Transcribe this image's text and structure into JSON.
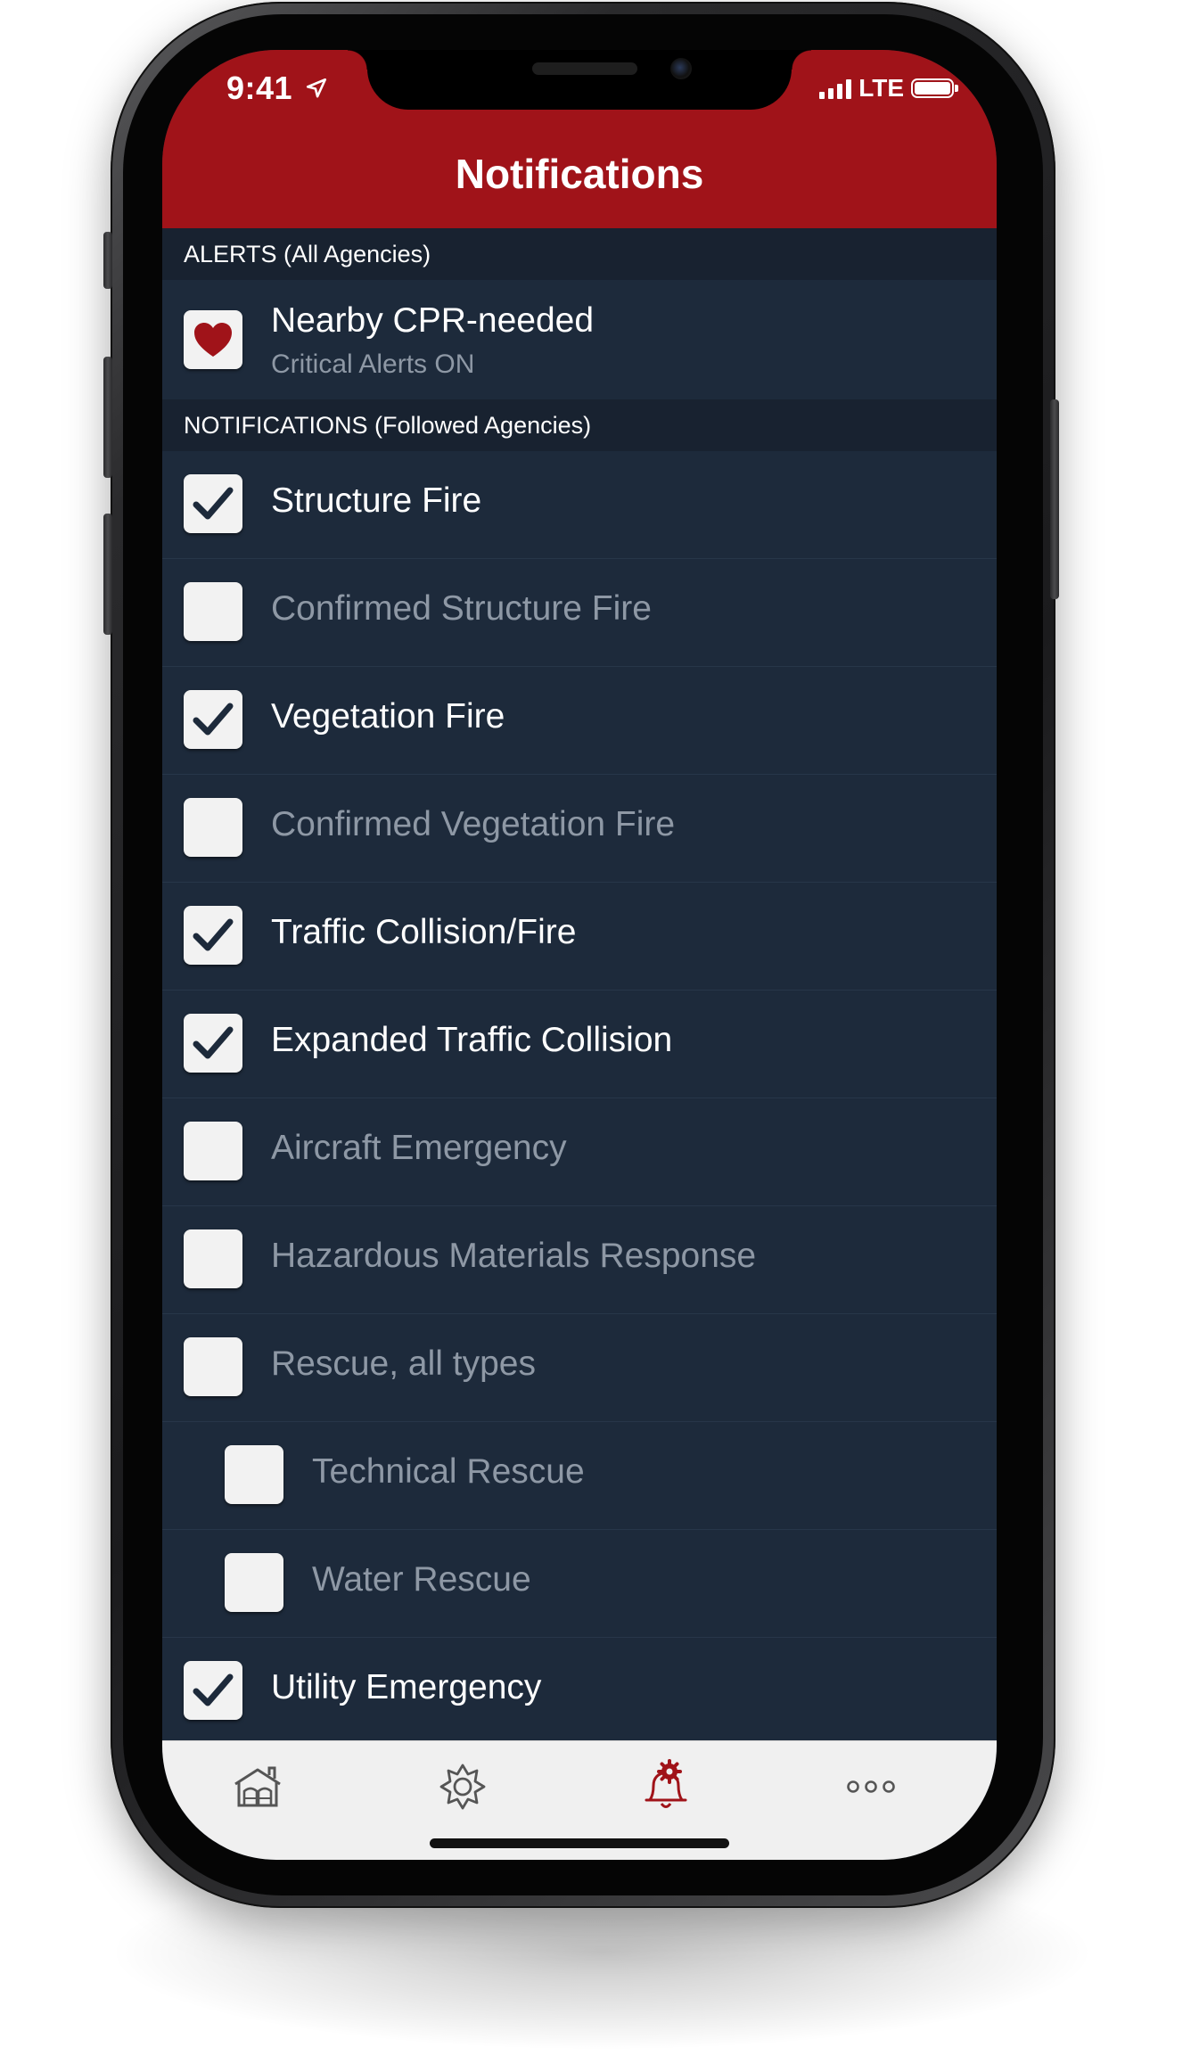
{
  "status_bar": {
    "time": "9:41",
    "network": "LTE",
    "icons": [
      "location-arrow-icon",
      "signal-bars-icon",
      "battery-icon"
    ]
  },
  "header": {
    "title": "Notifications",
    "color": "#a01319"
  },
  "alerts_section": {
    "header": "ALERTS (All Agencies)",
    "item": {
      "title": "Nearby CPR-needed",
      "subtitle": "Critical Alerts ON",
      "icon": "heart-icon"
    }
  },
  "notifications_section": {
    "header": "NOTIFICATIONS (Followed Agencies)",
    "items": [
      {
        "label": "Structure Fire",
        "checked": true,
        "indent": 0
      },
      {
        "label": "Confirmed Structure Fire",
        "checked": false,
        "indent": 0
      },
      {
        "label": "Vegetation Fire",
        "checked": true,
        "indent": 0
      },
      {
        "label": "Confirmed Vegetation Fire",
        "checked": false,
        "indent": 0
      },
      {
        "label": "Traffic Collision/Fire",
        "checked": true,
        "indent": 0
      },
      {
        "label": "Expanded Traffic Collision",
        "checked": true,
        "indent": 0
      },
      {
        "label": "Aircraft Emergency",
        "checked": false,
        "indent": 0
      },
      {
        "label": "Hazardous Materials Response",
        "checked": false,
        "indent": 0
      },
      {
        "label": "Rescue, all types",
        "checked": false,
        "indent": 0
      },
      {
        "label": "Technical Rescue",
        "checked": false,
        "indent": 1
      },
      {
        "label": "Water Rescue",
        "checked": false,
        "indent": 1
      },
      {
        "label": "Utility Emergency",
        "checked": true,
        "indent": 0
      }
    ]
  },
  "tab_bar": {
    "tabs": [
      {
        "icon": "fire-station-icon",
        "active": false
      },
      {
        "icon": "fire-department-badge-icon",
        "active": false
      },
      {
        "icon": "notification-bell-gear-icon",
        "active": true
      },
      {
        "icon": "more-dots-icon",
        "active": false
      }
    ],
    "active_color": "#a01319",
    "inactive_color": "#555555"
  }
}
